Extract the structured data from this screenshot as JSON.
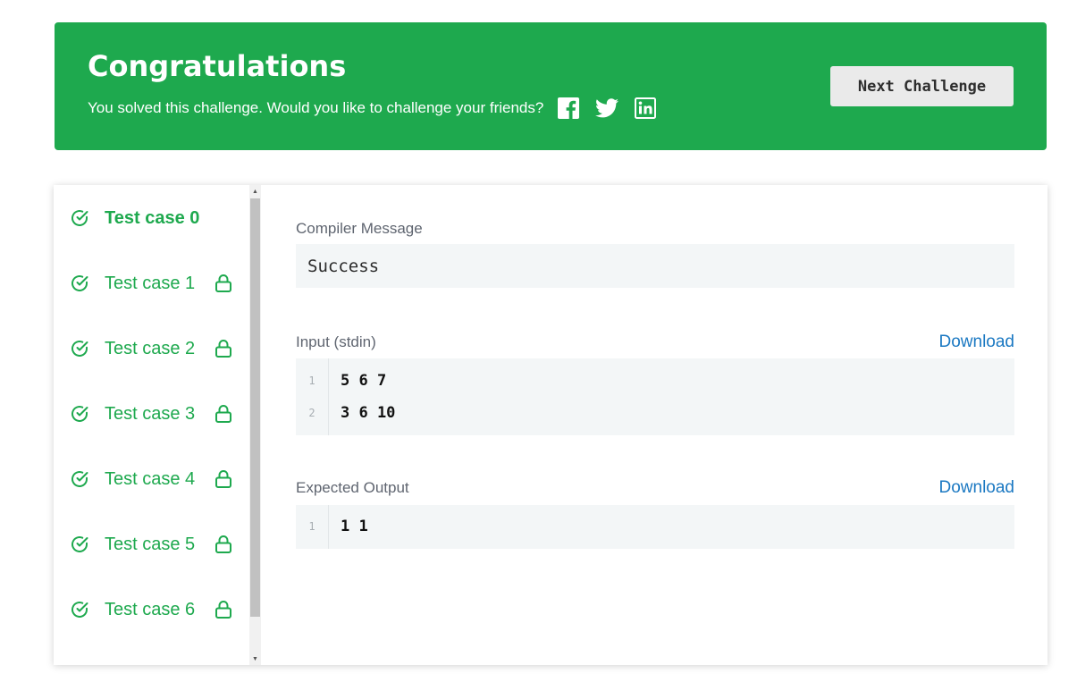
{
  "banner": {
    "title": "Congratulations",
    "subtitle": "You solved this challenge. Would you like to challenge your friends?",
    "social_icons": [
      "facebook-icon",
      "twitter-icon",
      "linkedin-icon"
    ],
    "next_label": "Next Challenge",
    "color": "#1ea94e"
  },
  "test_cases": [
    {
      "label": "Test case 0",
      "locked": false,
      "active": true
    },
    {
      "label": "Test case 1",
      "locked": true,
      "active": false
    },
    {
      "label": "Test case 2",
      "locked": true,
      "active": false
    },
    {
      "label": "Test case 3",
      "locked": true,
      "active": false
    },
    {
      "label": "Test case 4",
      "locked": true,
      "active": false
    },
    {
      "label": "Test case 5",
      "locked": true,
      "active": false
    },
    {
      "label": "Test case 6",
      "locked": true,
      "active": false
    }
  ],
  "compiler": {
    "label": "Compiler Message",
    "message": "Success"
  },
  "input": {
    "label": "Input (stdin)",
    "download": "Download",
    "line_numbers": [
      "1",
      "2"
    ],
    "lines": [
      "5 6 7",
      "3 6 10"
    ]
  },
  "expected": {
    "label": "Expected Output",
    "download": "Download",
    "line_numbers": [
      "1"
    ],
    "lines": [
      "1 1"
    ]
  }
}
